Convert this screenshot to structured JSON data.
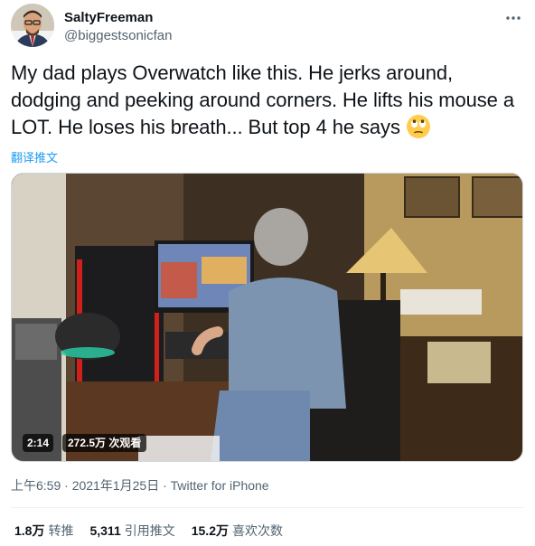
{
  "author": {
    "display_name": "SaltyFreeman",
    "handle": "@biggestsonicfan"
  },
  "tweet": {
    "text": "My dad plays Overwatch like this. He jerks around, dodging and peeking around corners. He lifts his mouse a LOT. He loses his breath... But top 4 he says",
    "emoji": "face-with-rolling-eyes",
    "translate_label": "翻译推文"
  },
  "video": {
    "duration": "2:14",
    "views": "272.5万 次观看"
  },
  "meta": {
    "timestamp": "上午6:59 · 2021年1月25日",
    "separator": " · ",
    "source": "Twitter for iPhone"
  },
  "stats": [
    {
      "value": "1.8万",
      "label": "转推"
    },
    {
      "value": "5,311",
      "label": "引用推文"
    },
    {
      "value": "15.2万",
      "label": "喜欢次数"
    }
  ],
  "colors": {
    "accent": "#1d9bf0",
    "secondary_text": "#536471",
    "primary_text": "#0f1419"
  }
}
